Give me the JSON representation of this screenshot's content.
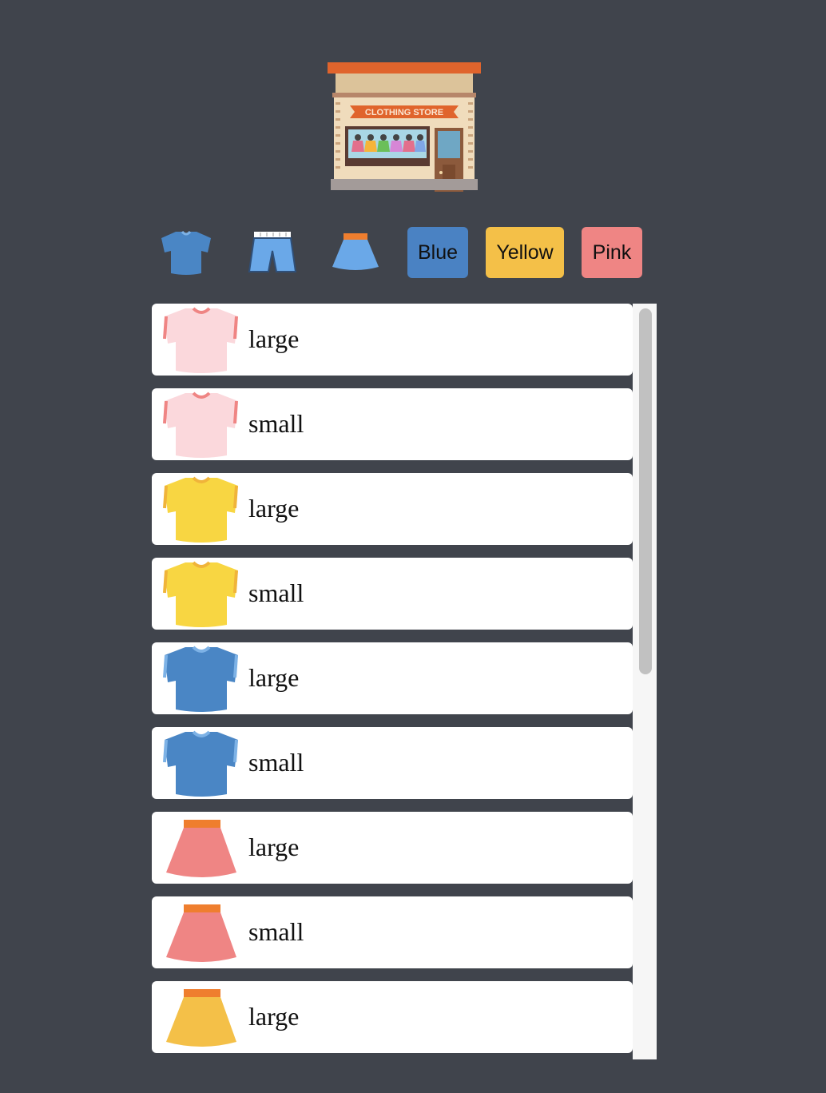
{
  "store": {
    "sign_text": "CLOTHING STORE"
  },
  "filters": {
    "categories": [
      {
        "name": "shirt-filter",
        "icon": "tshirt-icon"
      },
      {
        "name": "shorts-filter",
        "icon": "shorts-icon"
      },
      {
        "name": "skirt-filter",
        "icon": "skirt-icon"
      }
    ],
    "colors": [
      {
        "label": "Blue",
        "color": "#4a82c3"
      },
      {
        "label": "Yellow",
        "color": "#f4c048"
      },
      {
        "label": "Pink",
        "color": "#ef8584"
      }
    ]
  },
  "items": [
    {
      "type": "tshirt-icon",
      "color": "#fbd8dc",
      "accent": "#ef8584",
      "size": "large"
    },
    {
      "type": "tshirt-icon",
      "color": "#fbd8dc",
      "accent": "#ef8584",
      "size": "small"
    },
    {
      "type": "tshirt-icon",
      "color": "#f8d642",
      "accent": "#f0b43a",
      "size": "large"
    },
    {
      "type": "tshirt-icon",
      "color": "#f8d642",
      "accent": "#f0b43a",
      "size": "small"
    },
    {
      "type": "tshirt-icon",
      "color": "#4a86c5",
      "accent": "#7db2e6",
      "size": "large"
    },
    {
      "type": "tshirt-icon",
      "color": "#4a86c5",
      "accent": "#7db2e6",
      "size": "small"
    },
    {
      "type": "skirt-icon",
      "color": "#ef8584",
      "accent": "#ef7e2e",
      "size": "large"
    },
    {
      "type": "skirt-icon",
      "color": "#ef8584",
      "accent": "#ef7e2e",
      "size": "small"
    },
    {
      "type": "skirt-icon",
      "color": "#f4c048",
      "accent": "#ef7e2e",
      "size": "large"
    }
  ]
}
